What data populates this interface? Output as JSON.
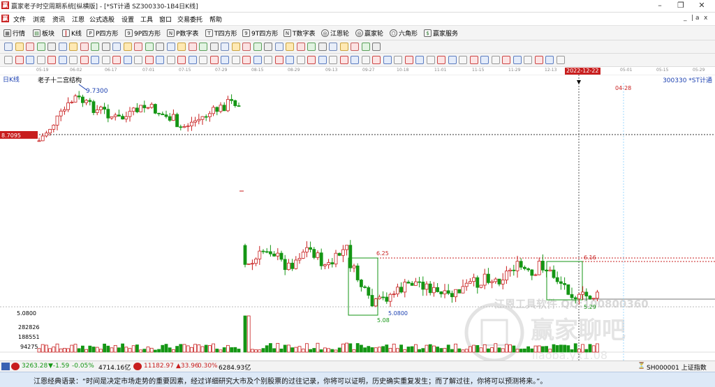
{
  "window": {
    "title": "赢家老子时空周期系统[纵横版] - [*ST计通  SZ300330-1B4日K线]",
    "controls": [
      "–",
      "❐",
      "✕"
    ]
  },
  "menu": {
    "items": [
      "文件",
      "浏览",
      "资讯",
      "江恩",
      "公式选股",
      "设置",
      "工具",
      "窗口",
      "交易委托",
      "帮助"
    ],
    "right": [
      "_",
      "|",
      "a",
      "x"
    ]
  },
  "toolbar": {
    "items": [
      {
        "icon": "grid-icon",
        "label": "行情"
      },
      {
        "icon": "blocks-icon",
        "label": "板块"
      },
      {
        "icon": "candle-icon",
        "label": "K线"
      },
      {
        "icon": "square-p-icon",
        "label": "P四方形"
      },
      {
        "icon": "square-9p-icon",
        "label": "9P四方形"
      },
      {
        "icon": "table-pn-icon",
        "label": "P数字表"
      },
      {
        "icon": "square-t-icon",
        "label": "T四方形"
      },
      {
        "icon": "square-9t-icon",
        "label": "9T四方形"
      },
      {
        "icon": "table-tn-icon",
        "label": "T数字表"
      },
      {
        "icon": "wheel-icon",
        "label": "江恩轮"
      },
      {
        "icon": "wheel-icon",
        "label": "赢家轮"
      },
      {
        "icon": "hexagon-icon",
        "label": "六角形"
      },
      {
        "icon": "dollar-icon",
        "label": "赢家服务"
      }
    ]
  },
  "timeaxis": {
    "labels": [
      "05-19",
      "06-02",
      "06-17",
      "07-01",
      "07-15",
      "07-29",
      "08-15",
      "08-29",
      "09-13",
      "09-27",
      "10-18",
      "11-01",
      "11-15",
      "11-29",
      "12-13",
      "2022-12-22",
      "05-01",
      "05-15",
      "05-29"
    ]
  },
  "chart": {
    "period_label": "日K线",
    "overlay_title": "老子十二宫结构",
    "stock": "300330  *ST计通",
    "top_price_line": "8.7095",
    "annotations": {
      "high": "9.7300",
      "top_right_date": "04-28",
      "box1_high": "6.25",
      "box1_low": "5.08",
      "low_mark": "5.0800",
      "box2_high": "6.16",
      "box2_low": "5.29"
    },
    "price_axis": [
      "5.0800"
    ],
    "volume_axis": [
      "282826",
      "188551",
      "94275"
    ],
    "watermark_text": "江恩工具软件 QQ:100800360",
    "watermark_logo": "赢家聊吧",
    "watermark_sub": "liaoba.yx1.08"
  },
  "chart_data": {
    "type": "candlestick",
    "title": "",
    "symbol": "300330 *ST计通",
    "period": "日K线",
    "ylabels_shown": [
      "9.7300",
      "8.7095",
      "6.25",
      "6.16",
      "5.29",
      "5.08",
      "5.0800"
    ],
    "volume_axis_ticks": [
      282826,
      188551,
      94275
    ],
    "reference_lines": [
      8.7095,
      6.25,
      6.16
    ]
  },
  "statusbar": {
    "sh_index": "3263.28",
    "sh_change": "▼-1.59",
    "sh_pct": "-0.05%",
    "sh_amount": "4714.16亿",
    "sz_index": "11182.97",
    "sz_change": "▲33.96",
    "sz_pct": "0.30%",
    "sz_amount": "6284.93亿",
    "right_code": "SH000001 上证指数"
  },
  "quote": {
    "text": "江恩经典语录：“时间是决定市场走势的重要因素，经过详细研究大市及个别股票的过往记录，你将可以证明，历史确实重复发生；而了解过往，你将可以预测将来。”。"
  },
  "colors": {
    "up": "#c81e1e",
    "down": "#149614",
    "price_label_bg": "#c81e1e",
    "quote_bg": "#dde9f7"
  }
}
